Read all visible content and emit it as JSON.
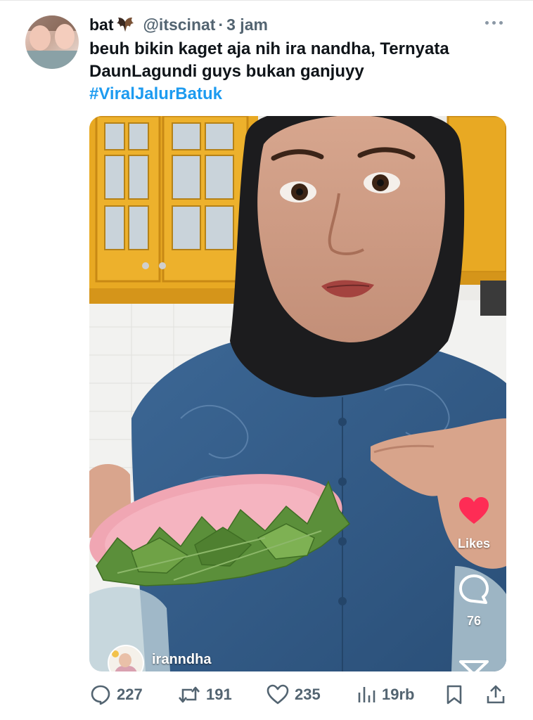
{
  "tweet": {
    "author_name": "bat",
    "author_name_emoji": "bat-emoji-icon",
    "handle": "@itscinat",
    "separator": "·",
    "time": "3 jam",
    "text_line1": "beuh bikin kaget aja nih ira nandha, Ternyata",
    "text_line2": "DaunLagundi guys bukan ganjuyy",
    "hashtag": "#ViralJalurBatuk"
  },
  "video": {
    "likes_label": "Likes",
    "comment_count": "76",
    "creator_username": "iranndha",
    "like_color": "#fe2c55"
  },
  "actions": {
    "replies": "227",
    "retweets": "191",
    "likes": "235",
    "views": "19rb"
  },
  "colors": {
    "accent": "#1d9bf0",
    "secondary_text": "#536471",
    "primary_text": "#0f1419"
  }
}
